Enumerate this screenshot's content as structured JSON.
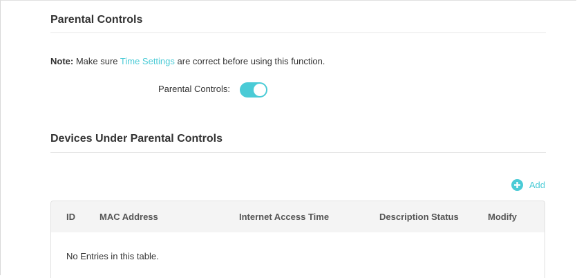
{
  "parental_controls": {
    "title": "Parental Controls",
    "note_prefix": "Note:",
    "note_before_link": " Make sure ",
    "note_link": "Time Settings",
    "note_after_link": " are correct before using this function.",
    "toggle_label": "Parental Controls:",
    "toggle_on": true
  },
  "devices": {
    "title": "Devices Under Parental Controls",
    "add_label": "Add",
    "columns": [
      "ID",
      "MAC Address",
      "Internet Access Time",
      "Description",
      "Status",
      "Modify"
    ],
    "empty_message": "No Entries in this table."
  },
  "colors": {
    "accent": "#4acbd6",
    "header_bg": "#f4f4f4"
  }
}
